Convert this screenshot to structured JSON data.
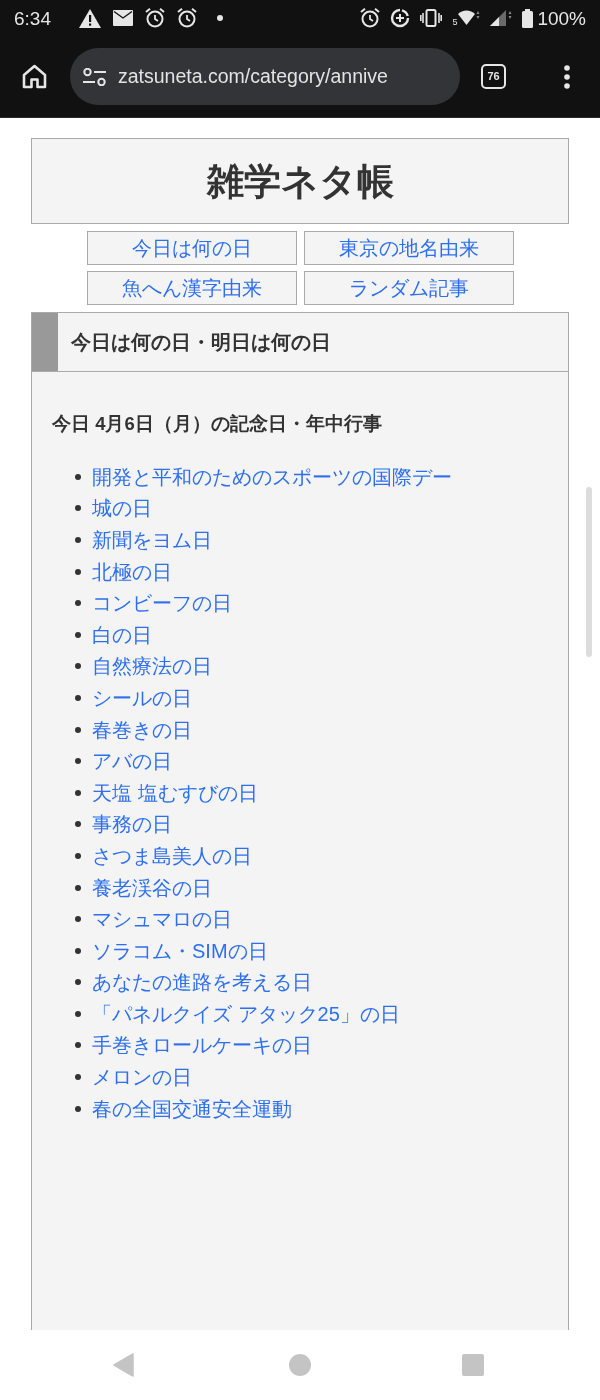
{
  "status_bar": {
    "time": "6:34",
    "wifi_band": "5",
    "battery": "100%"
  },
  "browser": {
    "url": "zatsuneta.com/category/annive",
    "tab_count": "76"
  },
  "site": {
    "title": "雑学ネタ帳",
    "nav_links": [
      "今日は何の日",
      "東京の地名由来",
      "魚へん漢字由来",
      "ランダム記事"
    ]
  },
  "section": {
    "heading": "今日は何の日・明日は何の日",
    "subheading": "今日 4月6日（月）の記念日・年中行事",
    "items": [
      "開発と平和のためのスポーツの国際デー",
      "城の日",
      "新聞をヨム日",
      "北極の日",
      "コンビーフの日",
      "白の日",
      "自然療法の日",
      "シールの日",
      "春巻きの日",
      "アバの日",
      "天塩 塩むすびの日",
      "事務の日",
      "さつま島美人の日",
      "養老渓谷の日",
      "マシュマロの日",
      "ソラコム・SIMの日",
      "あなたの進路を考える日",
      "「パネルクイズ アタック25」の日",
      "手巻きロールケーキの日",
      "メロンの日",
      "春の全国交通安全運動"
    ]
  }
}
